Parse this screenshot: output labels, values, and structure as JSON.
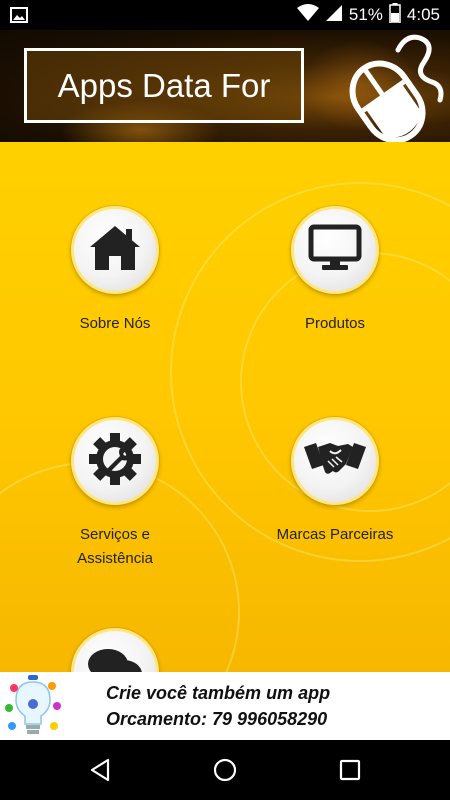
{
  "status_bar": {
    "battery": "51%",
    "time": "4:05",
    "icons": [
      "image-icon",
      "wifi-icon",
      "signal-icon",
      "battery-icon"
    ]
  },
  "header": {
    "title": "Apps Data For",
    "logo_icon": "computer-mouse-icon"
  },
  "menu": {
    "items": [
      {
        "label": "Sobre Nós",
        "icon": "home-icon"
      },
      {
        "label": "Produtos",
        "icon": "monitor-icon"
      },
      {
        "label": "Serviços e Assistência",
        "icon": "gear-wrench-icon"
      },
      {
        "label": "Marcas Parceiras",
        "icon": "handshake-icon"
      },
      {
        "label": "",
        "icon": "chat-bubbles-icon"
      }
    ]
  },
  "ad": {
    "line1": "Crie você também um app",
    "line2": "Orcamento: 79 996058290"
  },
  "nav": {
    "buttons": [
      "back-icon",
      "home-circle-icon",
      "recents-icon"
    ]
  },
  "colors": {
    "main_bg": "#ffc800",
    "header_bg": "#1b0f02",
    "icon_glyph": "#222222"
  }
}
